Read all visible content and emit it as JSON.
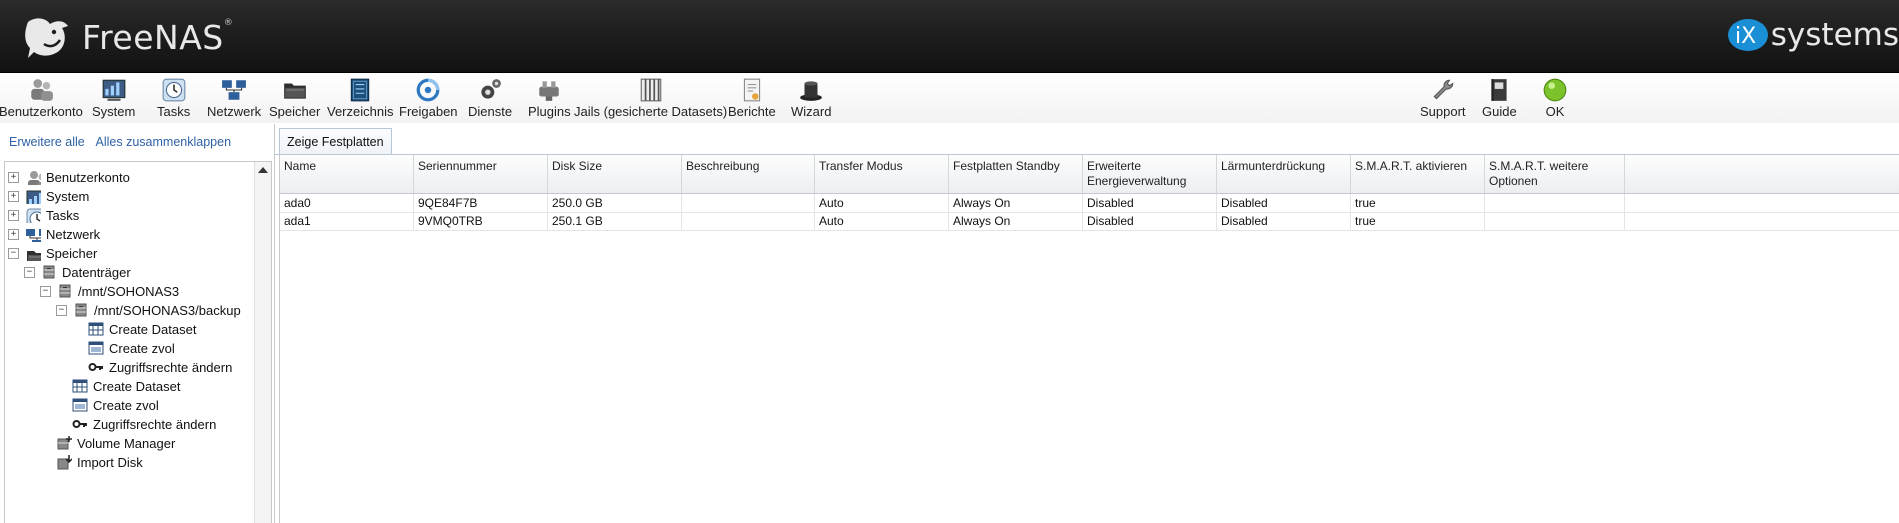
{
  "header": {
    "logo_text": "FreeNAS",
    "logo_tm": "®",
    "brand_text": "systems"
  },
  "toolbar": {
    "left_items": [
      {
        "label": "Benutzerkonto",
        "icon": "users-icon"
      },
      {
        "label": "System",
        "icon": "system-icon"
      },
      {
        "label": "Tasks",
        "icon": "clock-icon"
      },
      {
        "label": "Netzwerk",
        "icon": "network-icon"
      },
      {
        "label": "Speicher",
        "icon": "folder-icon"
      },
      {
        "label": "Verzeichnis",
        "icon": "directory-icon"
      },
      {
        "label": "Freigaben",
        "icon": "share-icon"
      },
      {
        "label": "Dienste",
        "icon": "gears-icon"
      },
      {
        "label": "Plugins",
        "icon": "plugins-icon"
      },
      {
        "label": "Jails (gesicherte Datasets)",
        "icon": "jails-icon"
      },
      {
        "label": "Berichte",
        "icon": "report-icon"
      },
      {
        "label": "Wizard",
        "icon": "wizard-hat-icon"
      }
    ],
    "right_items": [
      {
        "label": "Support",
        "icon": "wrench-icon"
      },
      {
        "label": "Guide",
        "icon": "guide-book-icon"
      },
      {
        "label": "OK",
        "icon": "status-ok-icon"
      }
    ]
  },
  "tree_panel": {
    "expand_all": "Erweitere alle",
    "collapse_all": "Alles zusammenklappen",
    "items": [
      {
        "label": "Benutzerkonto",
        "expander": "+",
        "icon": "users-icon"
      },
      {
        "label": "System",
        "expander": "+",
        "icon": "system-icon"
      },
      {
        "label": "Tasks",
        "expander": "+",
        "icon": "clock-icon"
      },
      {
        "label": "Netzwerk",
        "expander": "+",
        "icon": "network-icon"
      },
      {
        "label": "Speicher",
        "expander": "−",
        "icon": "folder-icon"
      },
      {
        "label": "Datenträger",
        "expander": "−",
        "icon": "volume-icon"
      },
      {
        "label": "/mnt/SOHONAS3",
        "expander": "−",
        "icon": "volume-icon"
      },
      {
        "label": "/mnt/SOHONAS3/backup",
        "expander": "−",
        "icon": "volume-icon"
      },
      {
        "label": "Create Dataset",
        "expander": "",
        "icon": "dataset-icon"
      },
      {
        "label": "Create zvol",
        "expander": "",
        "icon": "zvol-icon"
      },
      {
        "label": "Zugriffsrechte ändern",
        "expander": "",
        "icon": "key-icon"
      },
      {
        "label": "Create Dataset",
        "expander": "",
        "icon": "dataset-icon"
      },
      {
        "label": "Create zvol",
        "expander": "",
        "icon": "zvol-icon"
      },
      {
        "label": "Zugriffsrechte ändern",
        "expander": "",
        "icon": "key-icon"
      },
      {
        "label": "Volume Manager",
        "expander": "",
        "icon": "volume-manager-icon"
      },
      {
        "label": "Import Disk",
        "expander": "",
        "icon": "import-disk-icon"
      }
    ]
  },
  "main": {
    "tab_label": "Zeige Festplatten",
    "columns": [
      "Name",
      "Seriennummer",
      "Disk Size",
      "Beschreibung",
      "Transfer Modus",
      "Festplatten Standby",
      "Erweiterte Energieverwaltung",
      "Lärmunterdrückung",
      "S.M.A.R.T. aktivieren",
      "S.M.A.R.T. weitere Optionen"
    ],
    "rows": [
      [
        "ada0",
        "9QE84F7B",
        "250.0 GB",
        "",
        "Auto",
        "Always On",
        "Disabled",
        "Disabled",
        "true",
        ""
      ],
      [
        "ada1",
        "9VMQ0TRB",
        "250.1 GB",
        "",
        "Auto",
        "Always On",
        "Disabled",
        "Disabled",
        "true",
        ""
      ]
    ]
  },
  "colors": {
    "header_bg": "#1c1c1c",
    "link": "#2f62a6",
    "ix_blue": "#1a8fd6",
    "ok_green": "#7cc22a"
  }
}
